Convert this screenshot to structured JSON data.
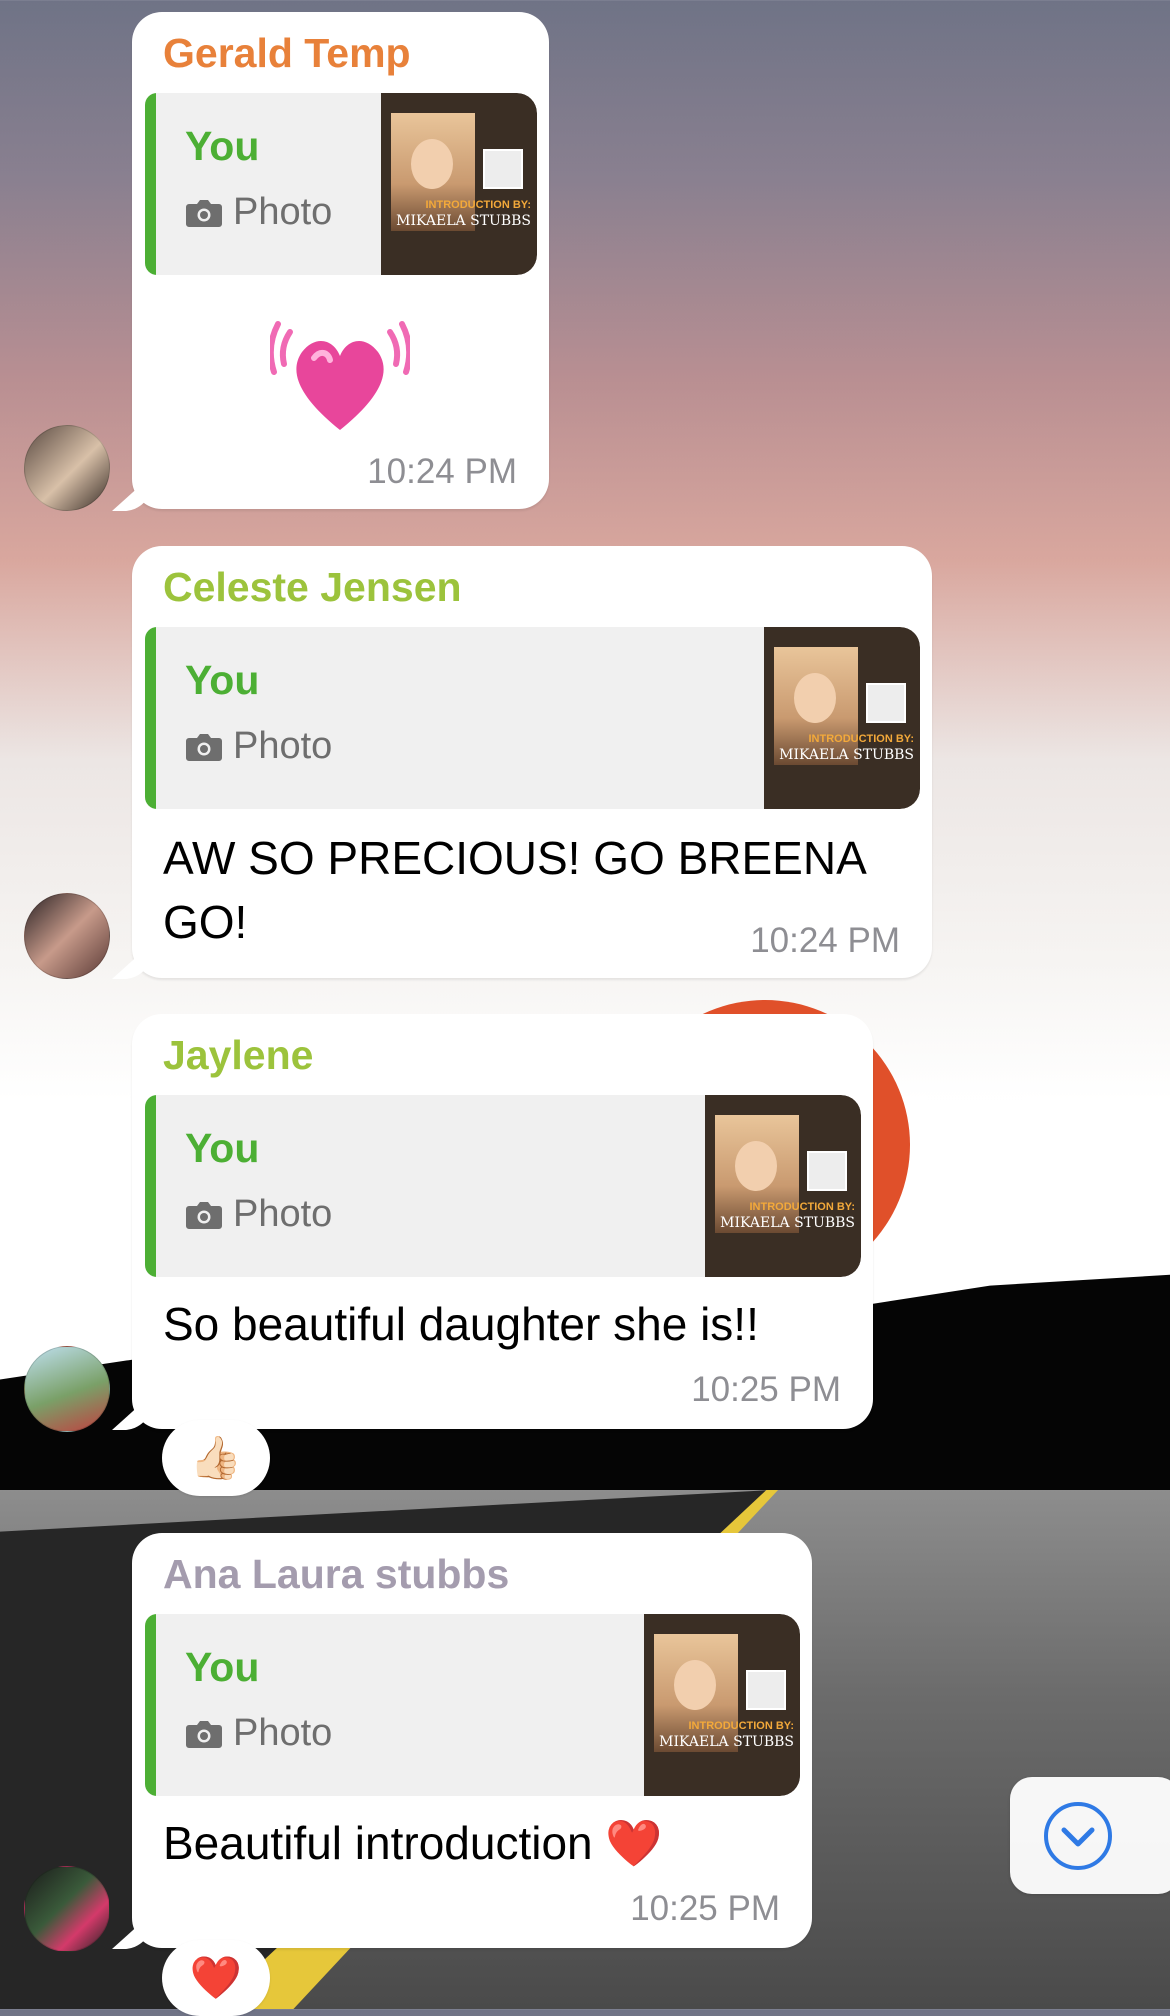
{
  "colors": {
    "sender_gerald": "#e8813a",
    "sender_celeste": "#9cc33c",
    "sender_jaylene": "#9cc33c",
    "sender_ana": "#a49cae",
    "reply_accent": "#4caf34",
    "timestamp": "#8e8e93",
    "scroll_button_accent": "#2f7ae5"
  },
  "messages": [
    {
      "sender": "Gerald Temp",
      "reply": {
        "name": "You",
        "type": "Photo",
        "thumb_caption": [
          "INTRODUCTION BY:",
          "MIKAELA STUBBS"
        ]
      },
      "text": "",
      "sticker": "pink-heart-sticker",
      "time": "10:24 PM",
      "reaction": ""
    },
    {
      "sender": "Celeste Jensen",
      "reply": {
        "name": "You",
        "type": "Photo",
        "thumb_caption": [
          "INTRODUCTION BY:",
          "MIKAELA STUBBS"
        ]
      },
      "text_lines": [
        "AW SO PRECIOUS! GO BREENA",
        "GO!"
      ],
      "time": "10:24 PM",
      "reaction": ""
    },
    {
      "sender": "Jaylene",
      "reply": {
        "name": "You",
        "type": "Photo",
        "thumb_caption": [
          "INTRODUCTION BY:",
          "MIKAELA STUBBS"
        ]
      },
      "text": "So beautiful daughter she is!!",
      "time": "10:25 PM",
      "reaction": "👍🏻"
    },
    {
      "sender": "Ana Laura stubbs",
      "reply": {
        "name": "You",
        "type": "Photo",
        "thumb_caption": [
          "INTRODUCTION BY:",
          "MIKAELA STUBBS"
        ]
      },
      "text": "Beautiful introduction ❤️",
      "time": "10:25 PM",
      "reaction": "❤️"
    }
  ],
  "scroll_button": {
    "icon": "chevron-down-circle-icon"
  }
}
